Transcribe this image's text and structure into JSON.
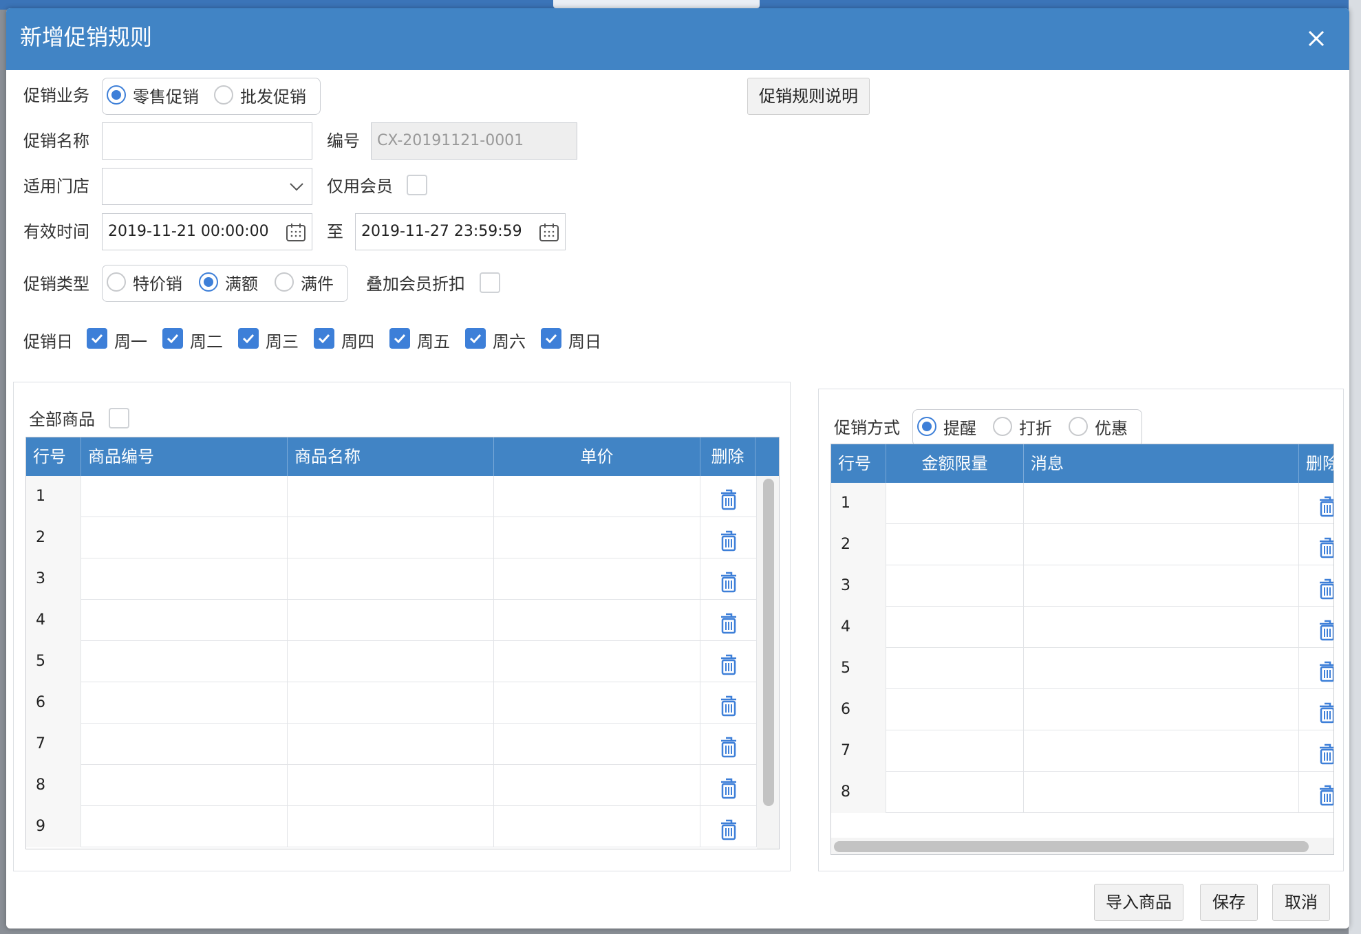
{
  "dialog": {
    "title": "新增促销规则",
    "close_icon": "close-icon"
  },
  "form": {
    "business_label": "促销业务",
    "business_options": [
      {
        "label": "零售促销",
        "checked": true
      },
      {
        "label": "批发促销",
        "checked": false
      }
    ],
    "rules_button": "促销规则说明",
    "name_label": "促销名称",
    "name_value": "",
    "code_label": "编号",
    "code_value": "CX-20191121-0001",
    "store_label": "适用门店",
    "store_value": "",
    "member_only_label": "仅用会员",
    "member_only_checked": false,
    "valid_time_label": "有效时间",
    "start_time": "2019-11-21 00:00:00",
    "to_label": "至",
    "end_time": "2019-11-27 23:59:59",
    "type_label": "促销类型",
    "type_options": [
      {
        "label": "特价销",
        "checked": false
      },
      {
        "label": "满额",
        "checked": true
      },
      {
        "label": "满件",
        "checked": false
      }
    ],
    "stack_member_label": "叠加会员折扣",
    "stack_member_checked": false,
    "days_label": "促销日",
    "days": [
      {
        "label": "周一",
        "checked": true
      },
      {
        "label": "周二",
        "checked": true
      },
      {
        "label": "周三",
        "checked": true
      },
      {
        "label": "周四",
        "checked": true
      },
      {
        "label": "周五",
        "checked": true
      },
      {
        "label": "周六",
        "checked": true
      },
      {
        "label": "周日",
        "checked": true
      }
    ]
  },
  "left_panel": {
    "all_goods_label": "全部商品",
    "all_goods_checked": false,
    "columns": [
      "行号",
      "商品编号",
      "商品名称",
      "单价",
      "删除"
    ],
    "rows": [
      "1",
      "2",
      "3",
      "4",
      "5",
      "6",
      "7",
      "8",
      "9"
    ]
  },
  "right_panel": {
    "method_label": "促销方式",
    "method_options": [
      {
        "label": "提醒",
        "checked": true
      },
      {
        "label": "打折",
        "checked": false
      },
      {
        "label": "优惠",
        "checked": false
      }
    ],
    "columns": [
      "行号",
      "金额限量",
      "消息",
      "删除"
    ],
    "rows": [
      "1",
      "2",
      "3",
      "4",
      "5",
      "6",
      "7",
      "8"
    ]
  },
  "footer": {
    "import_button": "导入商品",
    "save_button": "保存",
    "cancel_button": "取消"
  },
  "colors": {
    "header": "#4184c5",
    "accent": "#3d7fd8"
  }
}
